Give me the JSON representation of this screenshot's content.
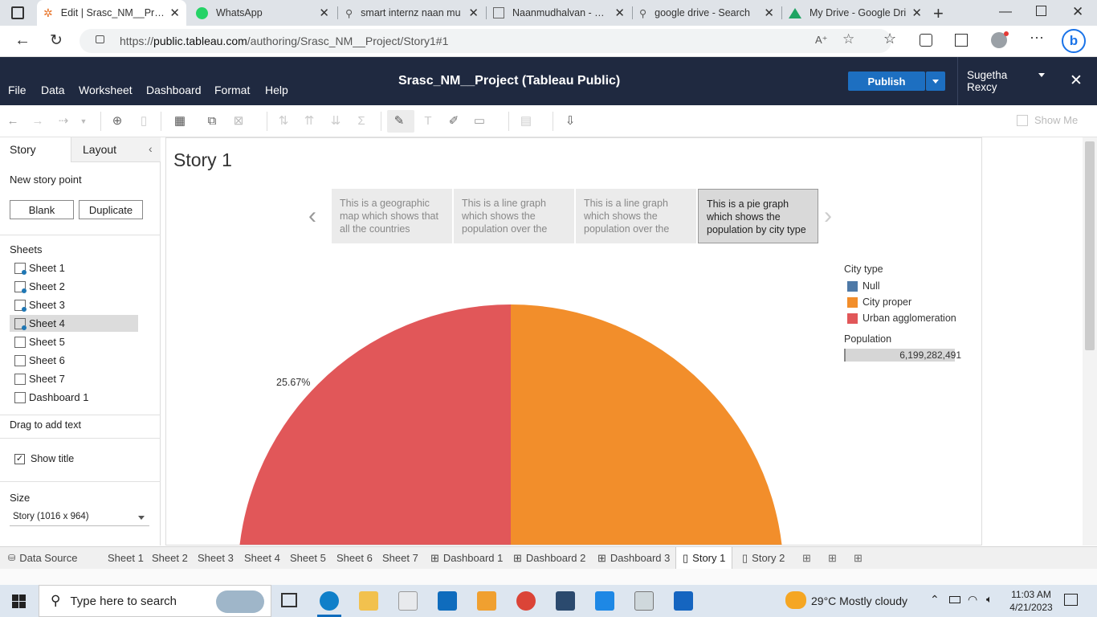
{
  "browser": {
    "tabs": [
      {
        "title": "Edit | Srasc_NM__Proje",
        "active": true
      },
      {
        "title": "WhatsApp"
      },
      {
        "title": "smart internz naan mu"
      },
      {
        "title": "Naanmudhalvan - Sma"
      },
      {
        "title": "google drive - Search"
      },
      {
        "title": "My Drive - Google Dri"
      }
    ],
    "url_prefix": "https://",
    "url_host": "public.tableau.com",
    "url_path": "/authoring/Srasc_NM__Project/Story1#1"
  },
  "tableau": {
    "menus": [
      "File",
      "Data",
      "Worksheet",
      "Dashboard",
      "Format",
      "Help"
    ],
    "workbook_title": "Srasc_NM__Project (Tableau Public)",
    "publish_label": "Publish",
    "user_name": "Sugetha Rexcy",
    "show_me": "Show Me"
  },
  "left_pane": {
    "tab_story": "Story",
    "tab_layout": "Layout",
    "new_story_point": "New story point",
    "blank_btn": "Blank",
    "duplicate_btn": "Duplicate",
    "sheets_header": "Sheets",
    "sheets": [
      "Sheet 1",
      "Sheet 2",
      "Sheet 3",
      "Sheet 4",
      "Sheet 5",
      "Sheet 6",
      "Sheet 7",
      "Dashboard 1"
    ],
    "selected_sheet": "Sheet 4",
    "drag_text": "Drag to add text",
    "show_title": "Show title",
    "size_header": "Size",
    "size_value": "Story (1016 x 964)"
  },
  "story": {
    "title": "Story 1",
    "points": [
      "This is a geographic map which shows that all the countries",
      "This is a line graph which shows the population over the",
      "This is a line graph which shows the population over the",
      "This is a pie graph which shows the population by city type"
    ],
    "legend_title": "City type",
    "legend_items": [
      {
        "label": "Null",
        "color": "#4e79a7"
      },
      {
        "label": "City proper",
        "color": "#f28e2b"
      },
      {
        "label": "Urban agglomeration",
        "color": "#e15759"
      }
    ],
    "size_legend_title": "Population",
    "size_legend_value": "6,199,282,491",
    "slice_label": "25.67%"
  },
  "chart_data": {
    "type": "pie",
    "categories": [
      "Urban agglomeration",
      "City proper",
      "Null"
    ],
    "colors": [
      "#e15759",
      "#f28e2b",
      "#4e79a7"
    ],
    "labels": [
      "25.67%"
    ]
  },
  "bottom_tabs": [
    "Data Source",
    "Sheet 1",
    "Sheet 2",
    "Sheet 3",
    "Sheet 4",
    "Sheet 5",
    "Sheet 6",
    "Sheet 7",
    "Dashboard 1",
    "Dashboard 2",
    "Dashboard 3",
    "Story 1",
    "Story 2"
  ],
  "active_bottom_tab": "Story 1",
  "taskbar": {
    "search_placeholder": "Type here to search",
    "weather": "29°C  Mostly cloudy",
    "time": "11:03 AM",
    "date": "4/21/2023"
  }
}
